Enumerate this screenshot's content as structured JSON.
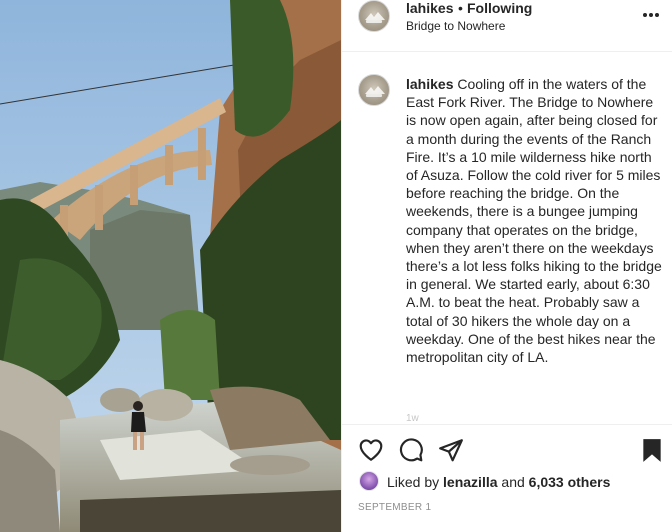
{
  "post": {
    "photo": {
      "alt": ""
    },
    "header": {
      "username": "lahikes",
      "separator": "•",
      "follow_status": "Following",
      "location": "Bridge to Nowhere",
      "more_icon": "more-horizontal-icon"
    },
    "caption": {
      "username": "lahikes",
      "text": "Cooling off in the waters of the East Fork River. The Bridge to Nowhere is now open again, after being closed for a month during the events of the Ranch Fire. It’s a 10 mile wilderness hike north of Asuza. Follow the cold river for 5 miles before reaching the bridge. On the weekends, there is a bungee jumping company that operates on the bridge, when they aren’t there on the weekdays there’s a lot less folks hiking to the bridge in general. We started early, about 6:30 A.M. to beat the heat. Probably saw a total of 30 hikers the whole day on a weekday. One of the best hikes near the metropolitan city of LA.",
      "timestamp": "1w"
    },
    "actions": {
      "like_icon": "heart-icon",
      "comment_icon": "comment-icon",
      "share_icon": "paper-plane-icon",
      "save_icon": "bookmark-icon"
    },
    "likes": {
      "prefix": "Liked by",
      "user": "lenazilla",
      "middle": "and",
      "others": "6,033 others"
    },
    "date": "SEPTEMBER 1"
  },
  "colors": {
    "text": "#262626",
    "secondary_text": "#8e8e8e",
    "divider": "#efefef"
  }
}
